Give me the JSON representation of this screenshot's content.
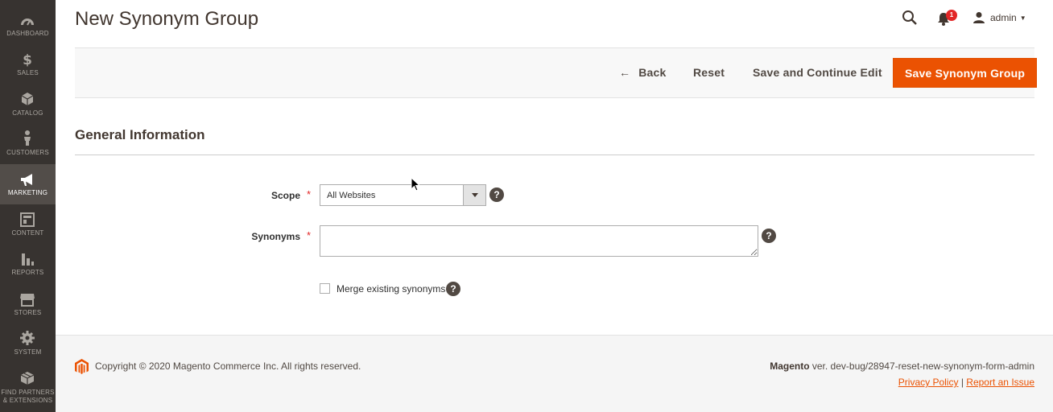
{
  "sidebar": {
    "items": [
      {
        "label": "DASHBOARD",
        "icon": "dashboard-icon",
        "active": false
      },
      {
        "label": "SALES",
        "icon": "dollar-icon",
        "active": false
      },
      {
        "label": "CATALOG",
        "icon": "cube-icon",
        "active": false
      },
      {
        "label": "CUSTOMERS",
        "icon": "person-icon",
        "active": false
      },
      {
        "label": "MARKETING",
        "icon": "megaphone-icon",
        "active": true
      },
      {
        "label": "CONTENT",
        "icon": "layout-icon",
        "active": false
      },
      {
        "label": "REPORTS",
        "icon": "bar-chart-icon",
        "active": false
      },
      {
        "label": "STORES",
        "icon": "store-icon",
        "active": false
      },
      {
        "label": "SYSTEM",
        "icon": "gear-icon",
        "active": false
      },
      {
        "label_line1": "FIND PARTNERS",
        "label_line2": "& EXTENSIONS",
        "icon": "box-icon",
        "active": false
      }
    ]
  },
  "header": {
    "title": "New Synonym Group",
    "notifications_count": "1",
    "user_name": "admin"
  },
  "actions": {
    "back": "Back",
    "reset": "Reset",
    "save_continue": "Save and Continue Edit",
    "save": "Save Synonym Group"
  },
  "form": {
    "section_title": "General Information",
    "scope_label": "Scope",
    "scope_value": "All Websites",
    "synonyms_label": "Synonyms",
    "synonyms_value": "",
    "merge_label": "Merge existing synonyms",
    "merge_checked": false,
    "required_mark": "*",
    "help_glyph": "?"
  },
  "footer": {
    "copyright": "Copyright © 2020 Magento Commerce Inc. All rights reserved.",
    "brand": "Magento",
    "version_text": " ver. dev-bug/28947-reset-new-synonym-form-admin",
    "privacy": "Privacy Policy",
    "separator": "|",
    "report": "Report an Issue"
  },
  "colors": {
    "sidebar_bg": "#373330",
    "sidebar_active": "#524d49",
    "accent": "#eb5202",
    "badge": "#e22626"
  }
}
